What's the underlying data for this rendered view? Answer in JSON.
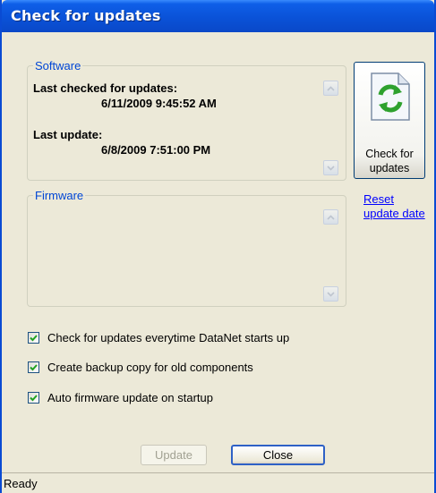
{
  "window": {
    "title": "Check for updates"
  },
  "software": {
    "legend": "Software",
    "last_checked_label": "Last checked for updates:",
    "last_checked_value": "6/11/2009 9:45:52 AM",
    "last_update_label": "Last update:",
    "last_update_value": "6/8/2009 7:51:00 PM"
  },
  "firmware": {
    "legend": "Firmware"
  },
  "check_button": {
    "line1": "Check for",
    "line2": "updates",
    "icon": "refresh-document-icon"
  },
  "reset_link": {
    "line1": "Reset",
    "line2": "update date"
  },
  "options": [
    {
      "label": "Check for updates everytime DataNet starts up",
      "checked": true
    },
    {
      "label": "Create backup copy for old components",
      "checked": true
    },
    {
      "label": "Auto firmware update on startup",
      "checked": true
    }
  ],
  "buttons": {
    "update": "Update",
    "close": "Close"
  },
  "status": {
    "text": "Ready"
  },
  "colors": {
    "title_bar": "#0a52d8",
    "group_legend": "#0046d5",
    "link": "#0000ff",
    "icon_green": "#2ea12e"
  }
}
